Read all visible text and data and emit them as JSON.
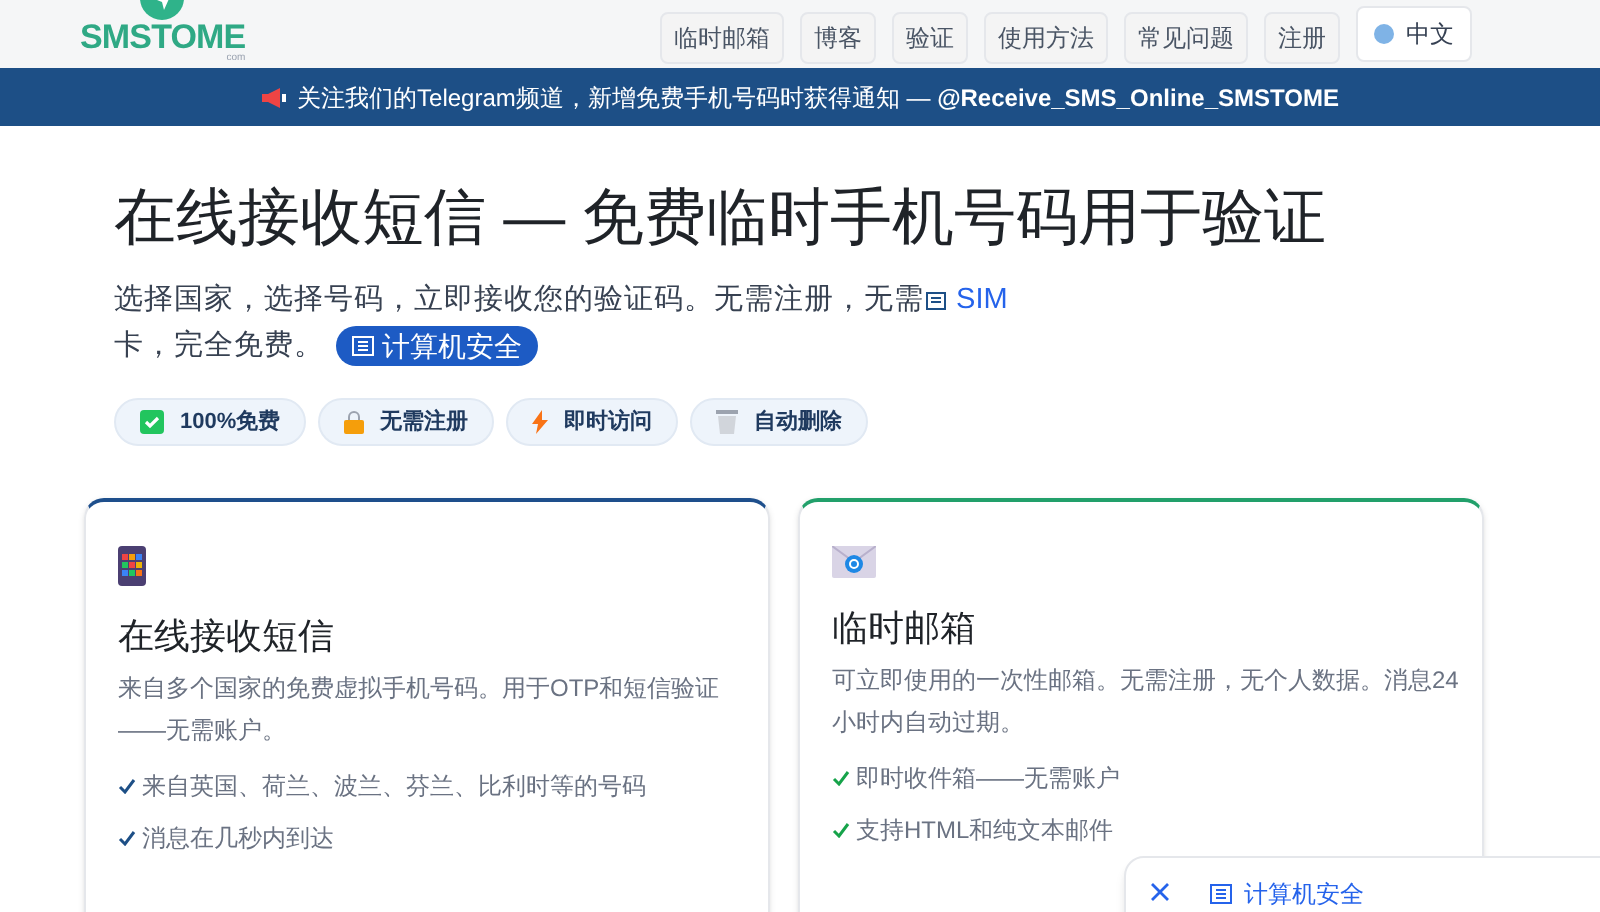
{
  "header": {
    "logo": "SMSTOME",
    "logo_sub": "com",
    "nav": [
      {
        "label": "临时邮箱"
      },
      {
        "label": "博客"
      },
      {
        "label": "验证"
      },
      {
        "label": "使用方法"
      },
      {
        "label": "常见问题"
      },
      {
        "label": "注册"
      }
    ],
    "language": "中文"
  },
  "banner": {
    "text": "关注我们的Telegram频道，新增免费手机号码时获得通知 — ",
    "handle": "@Receive_SMS_Online_SMSTOME"
  },
  "hero": {
    "title": "在线接收短信 — 免费临时手机号码用于验证",
    "subtitle_before": "选择国家，选择号码，立即接收您的验证码。无需注册，无需",
    "subtitle_link": "SIM",
    "subtitle_after": " 卡，完全免费。",
    "badge": "计算机安全"
  },
  "chips": [
    {
      "kind": "check",
      "label": "100%免费"
    },
    {
      "kind": "lock",
      "label": "无需注册"
    },
    {
      "kind": "bolt",
      "label": "即时访问"
    },
    {
      "kind": "trash",
      "label": "自动删除"
    }
  ],
  "cards": [
    {
      "color": "#1e4f8c",
      "title": "在线接收短信",
      "description": "来自多个国家的免费虚拟手机号码。用于OTP和短信验证——无需账户。",
      "features": [
        "来自英国、荷兰、波兰、芬兰、比利时等的号码",
        "消息在几秒内到达"
      ]
    },
    {
      "color": "#22a06b",
      "title": "临时邮箱",
      "description": "可立即使用的一次性邮箱。无需注册，无个人数据。消息24小时内自动过期。",
      "features": [
        "即时收件箱——无需账户",
        "支持HTML和纯文本邮件"
      ]
    }
  ],
  "popup": {
    "label": "计算机安全"
  }
}
